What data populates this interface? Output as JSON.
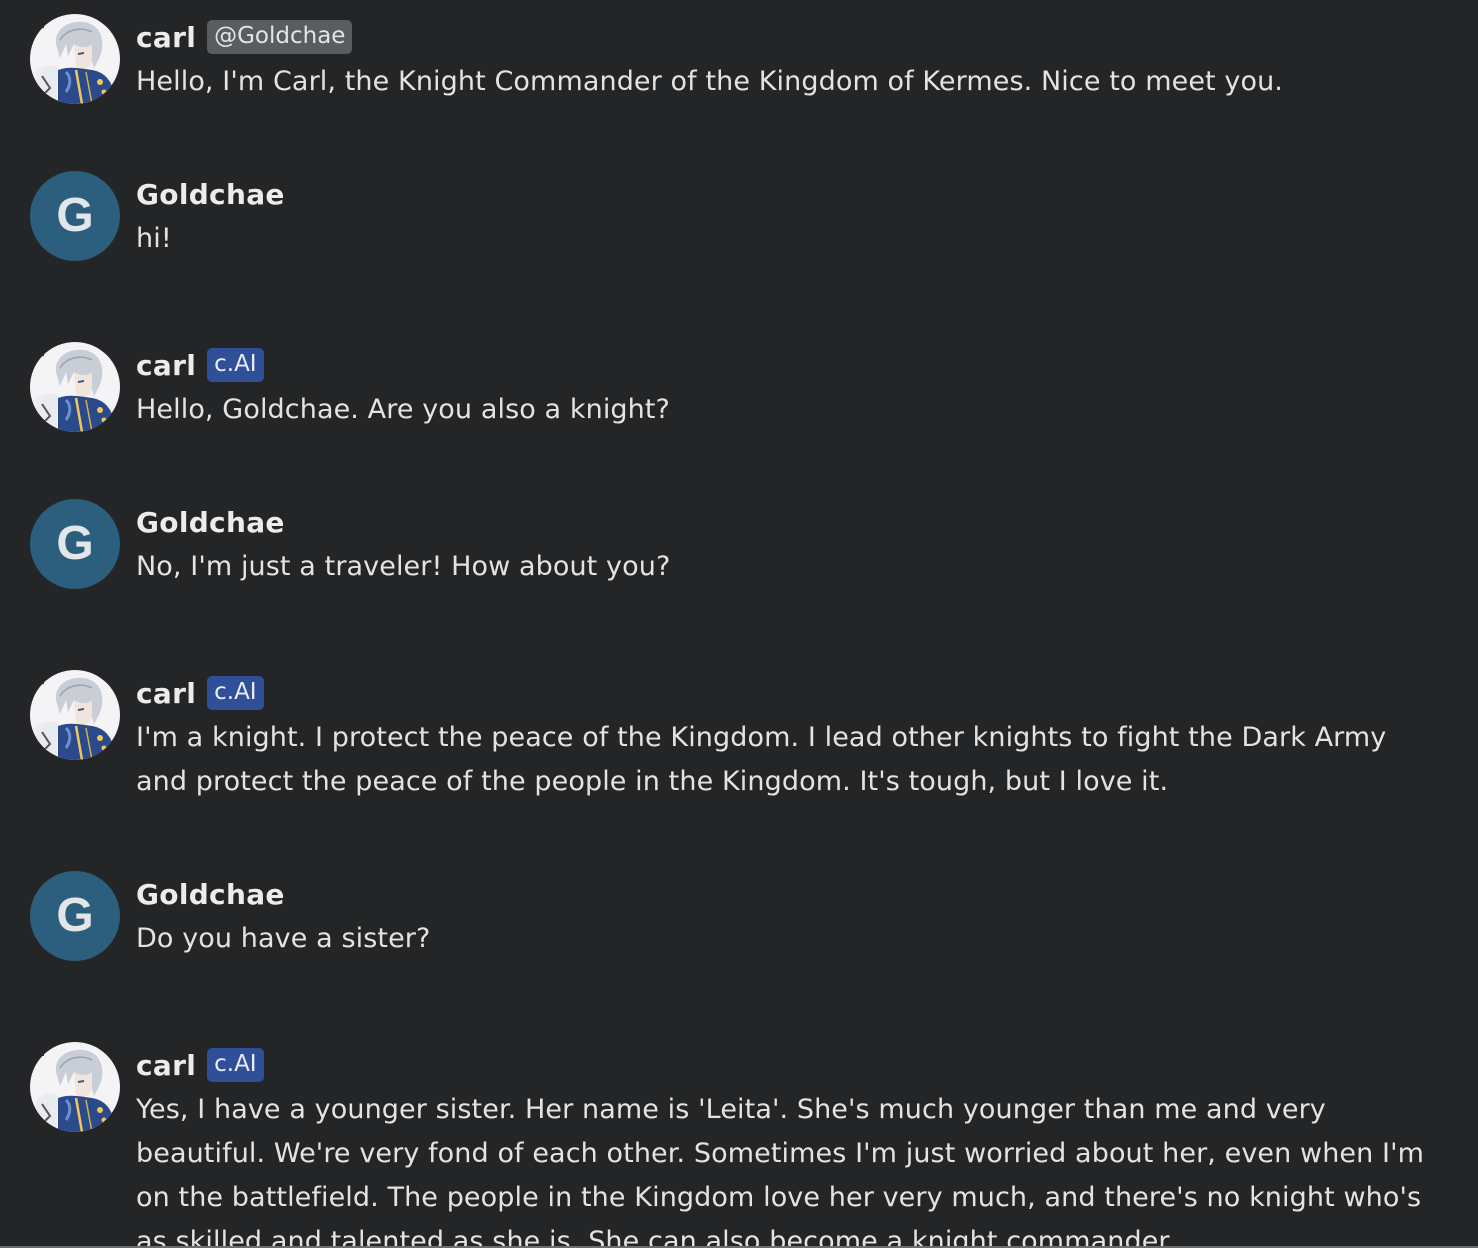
{
  "messages": [
    {
      "avatar_icon": "character-portrait-icon",
      "name": "carl",
      "badge": "@Goldchae",
      "badge_kind": "creator",
      "text": "Hello, I'm Carl, the Knight Commander of the Kingdom of Kermes. Nice to meet you."
    },
    {
      "avatar_letter": "G",
      "name": "Goldchae",
      "text": "hi!"
    },
    {
      "avatar_icon": "character-portrait-icon",
      "name": "carl",
      "badge": "c.AI",
      "badge_kind": "ai",
      "text": "Hello, Goldchae. Are you also a knight?"
    },
    {
      "avatar_letter": "G",
      "name": "Goldchae",
      "text": "No, I'm just a traveler! How about you?"
    },
    {
      "avatar_icon": "character-portrait-icon",
      "name": "carl",
      "badge": "c.AI",
      "badge_kind": "ai",
      "text": "I'm a knight. I protect the peace of the Kingdom. I lead other knights to fight the Dark Army and protect the peace of the people in the Kingdom. It's tough, but I love it."
    },
    {
      "avatar_letter": "G",
      "name": "Goldchae",
      "text": "Do you have a sister?"
    },
    {
      "avatar_icon": "character-portrait-icon",
      "name": "carl",
      "badge": "c.AI",
      "badge_kind": "ai",
      "text": "Yes, I have a younger sister. Her name is 'Leita'. She's much younger than me and very beautiful. We're very fond of each other. Sometimes I'm just worried about her, even when I'm on the battlefield. The people in the Kingdom love her very much, and there's no knight who's as skilled and talented as she is. She can also become a knight commander."
    }
  ],
  "colors": {
    "background": "#242526",
    "user_avatar": "#2c5f7e",
    "ai_badge": "#2f4f99",
    "creator_badge": "#5a5d60"
  }
}
